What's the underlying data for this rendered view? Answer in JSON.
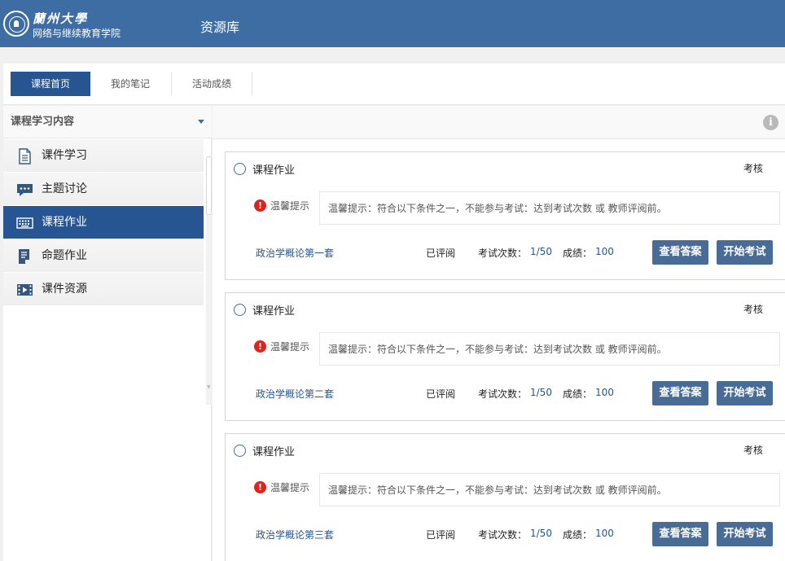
{
  "header": {
    "brand_top": "蘭州大學",
    "brand_sub": "网络与继续教育学院",
    "site_title": "资源库"
  },
  "tabs": [
    {
      "label": "课程首页",
      "active": true
    },
    {
      "label": "我的笔记",
      "active": false
    },
    {
      "label": "活动成绩",
      "active": false
    }
  ],
  "sidebar": {
    "title": "课程学习内容",
    "items": [
      {
        "label": "课件学习",
        "icon": "document-icon"
      },
      {
        "label": "主题讨论",
        "icon": "chat-bubble-icon"
      },
      {
        "label": "课程作业",
        "icon": "keyboard-icon",
        "active": true
      },
      {
        "label": "命题作业",
        "icon": "edit-document-icon"
      },
      {
        "label": "课件资源",
        "icon": "film-icon"
      }
    ]
  },
  "assignments": [
    {
      "title": "课程作业",
      "kind": "考核",
      "tip_label": "温馨提示",
      "tip_text": "温馨提示：符合以下条件之一，不能参与考试：达到考试次数 或 教师评阅前。",
      "set_name": "政治学概论第一套",
      "status": "已评阅",
      "attempts_label": "考试次数：",
      "attempts": "1/50",
      "score_label": "成绩：",
      "score": "100",
      "answer_btn": "查看答案",
      "start_btn": "开始考试"
    },
    {
      "title": "课程作业",
      "kind": "考核",
      "tip_label": "温馨提示",
      "tip_text": "温馨提示：符合以下条件之一，不能参与考试：达到考试次数 或 教师评阅前。",
      "set_name": "政治学概论第二套",
      "status": "已评阅",
      "attempts_label": "考试次数：",
      "attempts": "1/50",
      "score_label": "成绩：",
      "score": "100",
      "answer_btn": "查看答案",
      "start_btn": "开始考试"
    },
    {
      "title": "课程作业",
      "kind": "考核",
      "tip_label": "温馨提示",
      "tip_text": "温馨提示：符合以下条件之一，不能参与考试：达到考试次数 或 教师评阅前。",
      "set_name": "政治学概论第三套",
      "status": "已评阅",
      "attempts_label": "考试次数：",
      "attempts": "1/50",
      "score_label": "成绩：",
      "score": "100",
      "answer_btn": "查看答案",
      "start_btn": "开始考试"
    }
  ],
  "colors": {
    "header_bg": "#3d6da3",
    "accent": "#265591",
    "button": "#496c96",
    "warning": "#e0211c"
  }
}
